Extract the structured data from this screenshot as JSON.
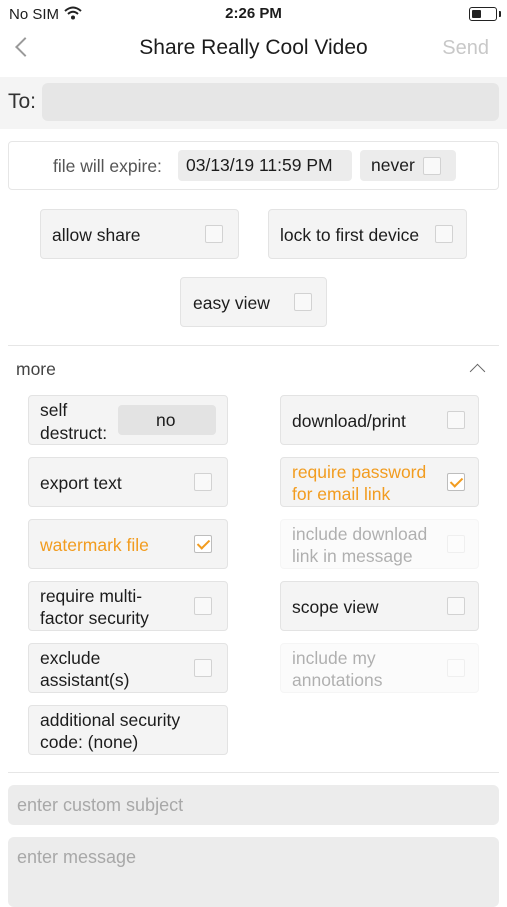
{
  "status_bar": {
    "carrier": "No SIM",
    "time": "2:26 PM"
  },
  "nav": {
    "title": "Share Really Cool Video",
    "send_label": "Send"
  },
  "to": {
    "label": "To:"
  },
  "expire": {
    "label": "file will expire:",
    "date": "03/13/19 11:59 PM",
    "never_label": "never",
    "never_checked": false
  },
  "options": {
    "allow_share": {
      "label": "allow share",
      "checked": false
    },
    "lock_first_device": {
      "label": "lock to first device",
      "checked": false
    },
    "easy_view": {
      "label": "easy view",
      "checked": false
    }
  },
  "more": {
    "label": "more",
    "self_destruct": {
      "label_line1": "self",
      "label_line2": "destruct:",
      "value": "no"
    },
    "download_print": {
      "label": "download/print",
      "checked": false
    },
    "export_text": {
      "label": "export text",
      "checked": false
    },
    "require_password": {
      "label_line1": "require password",
      "label_line2": "for email link",
      "checked": true
    },
    "watermark_file": {
      "label": "watermark file",
      "checked": true
    },
    "include_download_link": {
      "label_line1": "include download",
      "label_line2": "link in message",
      "checked": false
    },
    "require_mfa": {
      "label_line1": "require multi-",
      "label_line2": "factor security",
      "checked": false
    },
    "scope_view": {
      "label": "scope view",
      "checked": false
    },
    "exclude_assistants": {
      "label_line1": "exclude",
      "label_line2": "assistant(s)",
      "checked": false
    },
    "include_annotations": {
      "label_line1": "include my",
      "label_line2": "annotations",
      "checked": false
    },
    "additional_code": {
      "label_line1": "additional security",
      "label_line2": "code: (none)"
    }
  },
  "compose": {
    "subject_placeholder": "enter custom subject",
    "message_placeholder": "enter message"
  },
  "colors": {
    "accent": "#f29c1f",
    "send_disabled": "#c8c8c8"
  }
}
